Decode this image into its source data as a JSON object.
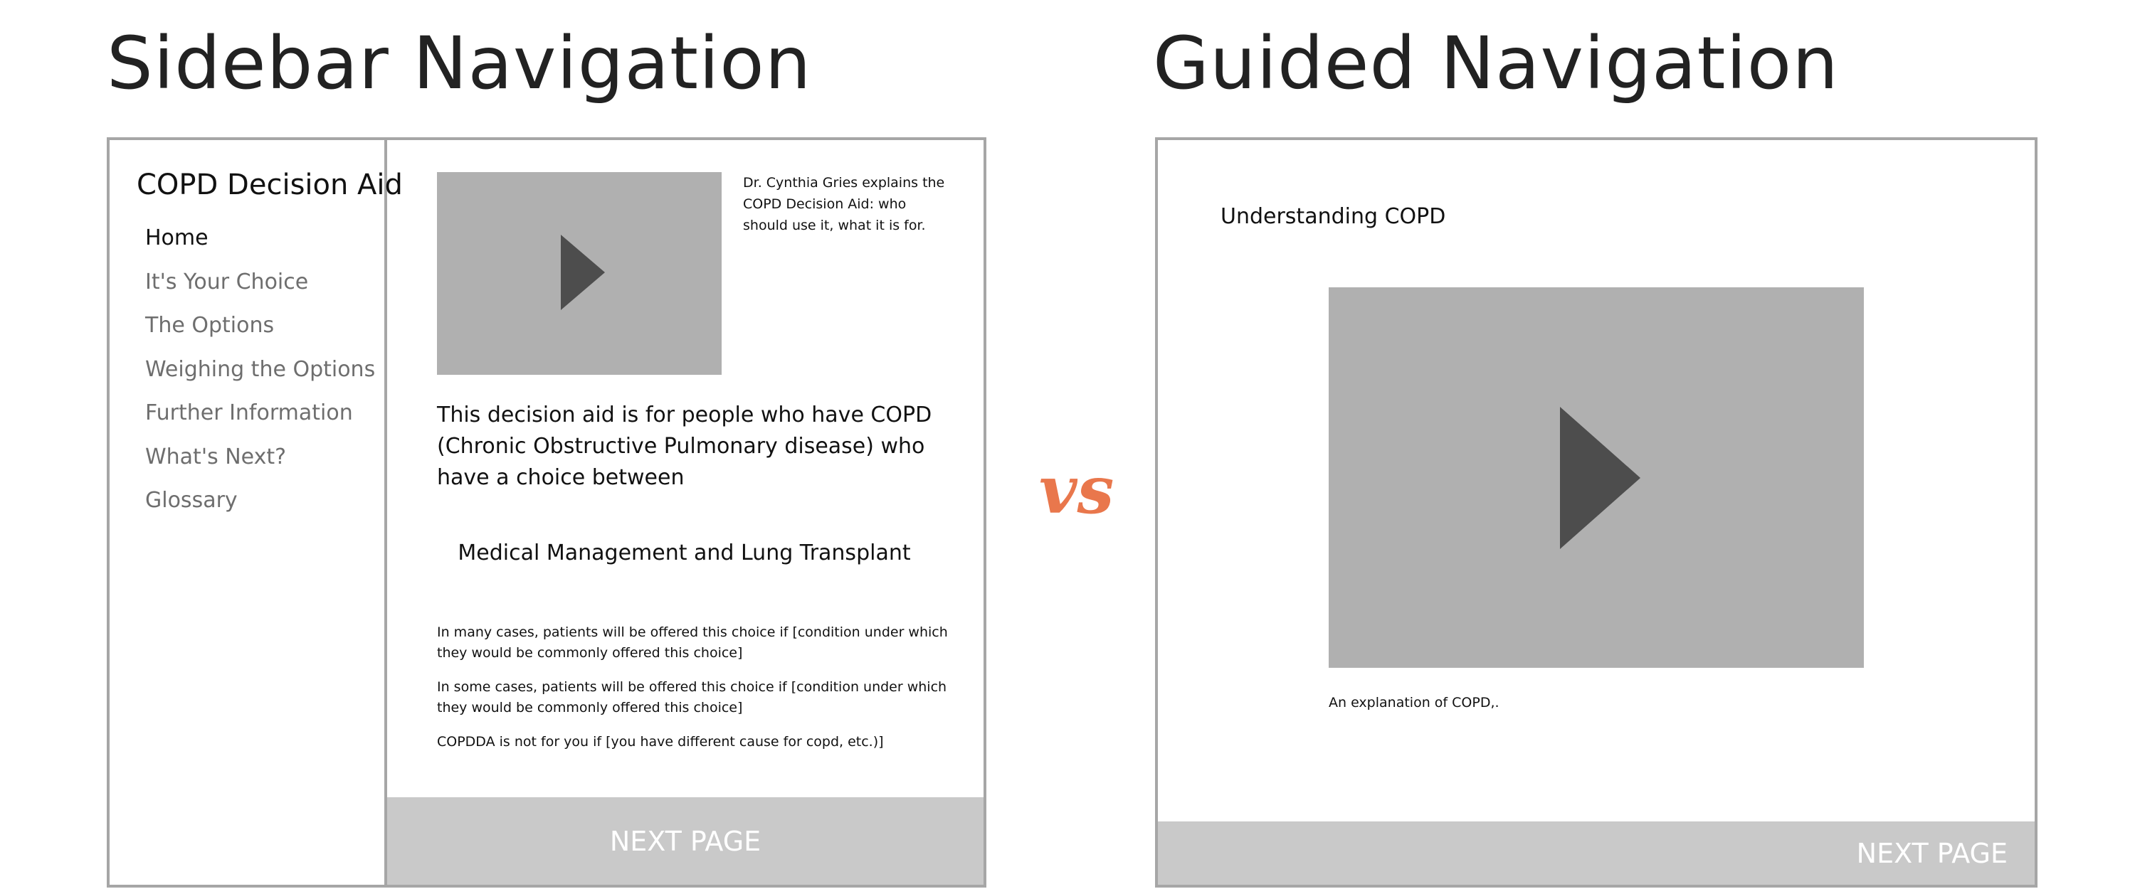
{
  "left": {
    "heading": "Sidebar Navigation",
    "sidebar": {
      "title": "COPD Decision Aid",
      "items": [
        {
          "label": "Home"
        },
        {
          "label": "It's Your Choice"
        },
        {
          "label": "The Options"
        },
        {
          "label": "Weighing the Options"
        },
        {
          "label": "Further Information"
        },
        {
          "label": "What's Next?"
        },
        {
          "label": "Glossary"
        }
      ]
    },
    "video_caption": "Dr. Cynthia Gries explains the COPD Decision Aid: who should use it, what it is for.",
    "lead_text": "This decision aid is for people who have COPD (Chronic Obstructive Pulmonary disease) who have a choice between",
    "options_text": "Medical Management and Lung Transplant",
    "notes": [
      "In many cases, patients will be offered this choice if [condition under which they would be commonly offered this choice]",
      "In some cases, patients will be offered this choice if [condition under which they would be commonly offered this choice]",
      "COPDDA is not for you if [you have different cause for copd, etc.)]"
    ],
    "next_button": "NEXT PAGE"
  },
  "vs_label": "vs",
  "right": {
    "heading": "Guided Navigation",
    "title": "Understanding COPD",
    "video_caption": "An explanation of COPD,.",
    "next_button": "NEXT PAGE"
  },
  "colors": {
    "accent": "#e9774c",
    "frame_border": "#a6a6a6",
    "video_placeholder": "#b0b0b0",
    "play_icon": "#4d4d4d",
    "button_bg": "#c9c9c9",
    "nav_inactive": "#6e6e6e"
  },
  "icons": {
    "video_play": "play-icon"
  }
}
